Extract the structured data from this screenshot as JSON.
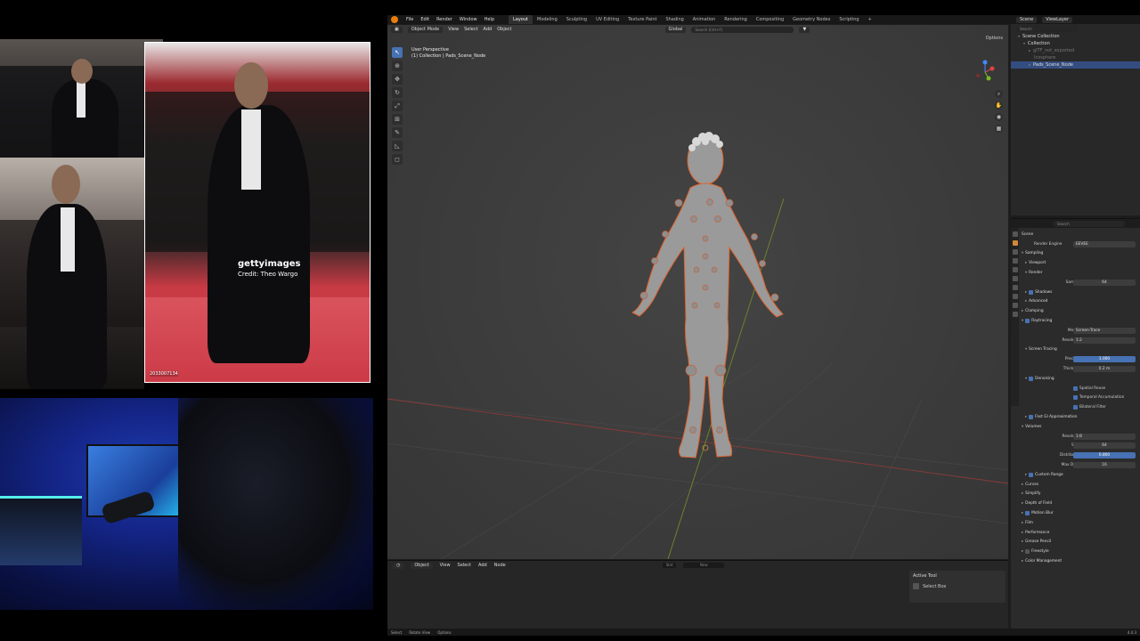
{
  "reference": {
    "watermark_brand": "gettyimages",
    "watermark_credit": "Credit: Theo Wargo",
    "photo_id": "2033007134"
  },
  "blender": {
    "menu": [
      "File",
      "Edit",
      "Render",
      "Window",
      "Help"
    ],
    "workspaces": [
      "Layout",
      "Modeling",
      "Sculpting",
      "UV Editing",
      "Texture Paint",
      "Shading",
      "Animation",
      "Rendering",
      "Compositing",
      "Geometry Nodes",
      "Scripting",
      "+"
    ],
    "active_workspace": "Layout",
    "viewport": {
      "mode": "Object Mode",
      "menus": [
        "View",
        "Select",
        "Add",
        "Object"
      ],
      "transform": "Global",
      "search_placeholder": "Search (Ctrl+F)",
      "view_name": "User Perspective",
      "collection_info": "(1) Collection | Pads_Scene_Node",
      "options": "Options"
    },
    "timeline": {
      "mode": "Object",
      "menus": [
        "View",
        "Select",
        "Add",
        "Node"
      ],
      "start_label": "Slot",
      "new_label": "New"
    },
    "active_tool": {
      "title": "Active Tool",
      "tool": "Select Box"
    },
    "status": {
      "items": [
        "Select",
        "Rotate View",
        "Options"
      ],
      "version": "4.4.3"
    },
    "outliner": {
      "scene": "Scene",
      "view_layer": "ViewLayer",
      "search_placeholder": "Search",
      "rows": [
        {
          "label": "Scene Collection",
          "level": 0
        },
        {
          "label": "Collection",
          "level": 1
        },
        {
          "label": "glTF_not_exported",
          "level": 2
        },
        {
          "label": "Icosphere",
          "level": 3
        },
        {
          "label": "Pads_Scene_Node",
          "level": 2
        }
      ],
      "selected_row": "Pads_Scene_Node"
    },
    "properties": {
      "search_placeholder": "Search",
      "scene_label": "Scene",
      "render_engine_label": "Render Engine",
      "render_engine": "EEVEE",
      "sampling": "Sampling",
      "viewport": "Viewport",
      "render": "Render",
      "samples_label": "Samples",
      "samples": "64",
      "shadows": "Shadows",
      "advanced": "Advanced",
      "clamping": "Clamping",
      "raytracing": "Raytracing",
      "method_label": "Method",
      "method": "Screen-Trace",
      "resolution_label": "Resolution",
      "resolution": "1:2",
      "screen_tracing": "Screen Tracing",
      "precision_label": "Precision",
      "precision": "1.000",
      "thickness_label": "Thickness",
      "thickness": "0.2 m",
      "denoising": "Denoising",
      "spatial_reuse": "Spatial Reuse",
      "temporal_accumulation": "Temporal Accumulation",
      "bilateral_filter": "Bilateral Filter",
      "fast_gi": "Fast GI Approximation",
      "volumes": "Volumes",
      "vol_resolution_label": "Resolution",
      "vol_resolution": "1:8",
      "steps_label": "Steps",
      "steps": "64",
      "distribution_label": "Distribution",
      "distribution": "0.800",
      "max_depth_label": "Max Depth",
      "max_depth": "16",
      "custom_range": "Custom Range",
      "curves": "Curves",
      "simplify": "Simplify",
      "depth_of_field": "Depth of Field",
      "motion_blur": "Motion Blur",
      "film": "Film",
      "performance": "Performance",
      "grease_pencil": "Grease Pencil",
      "freestyle": "Freestyle",
      "color_management": "Color Management"
    }
  }
}
